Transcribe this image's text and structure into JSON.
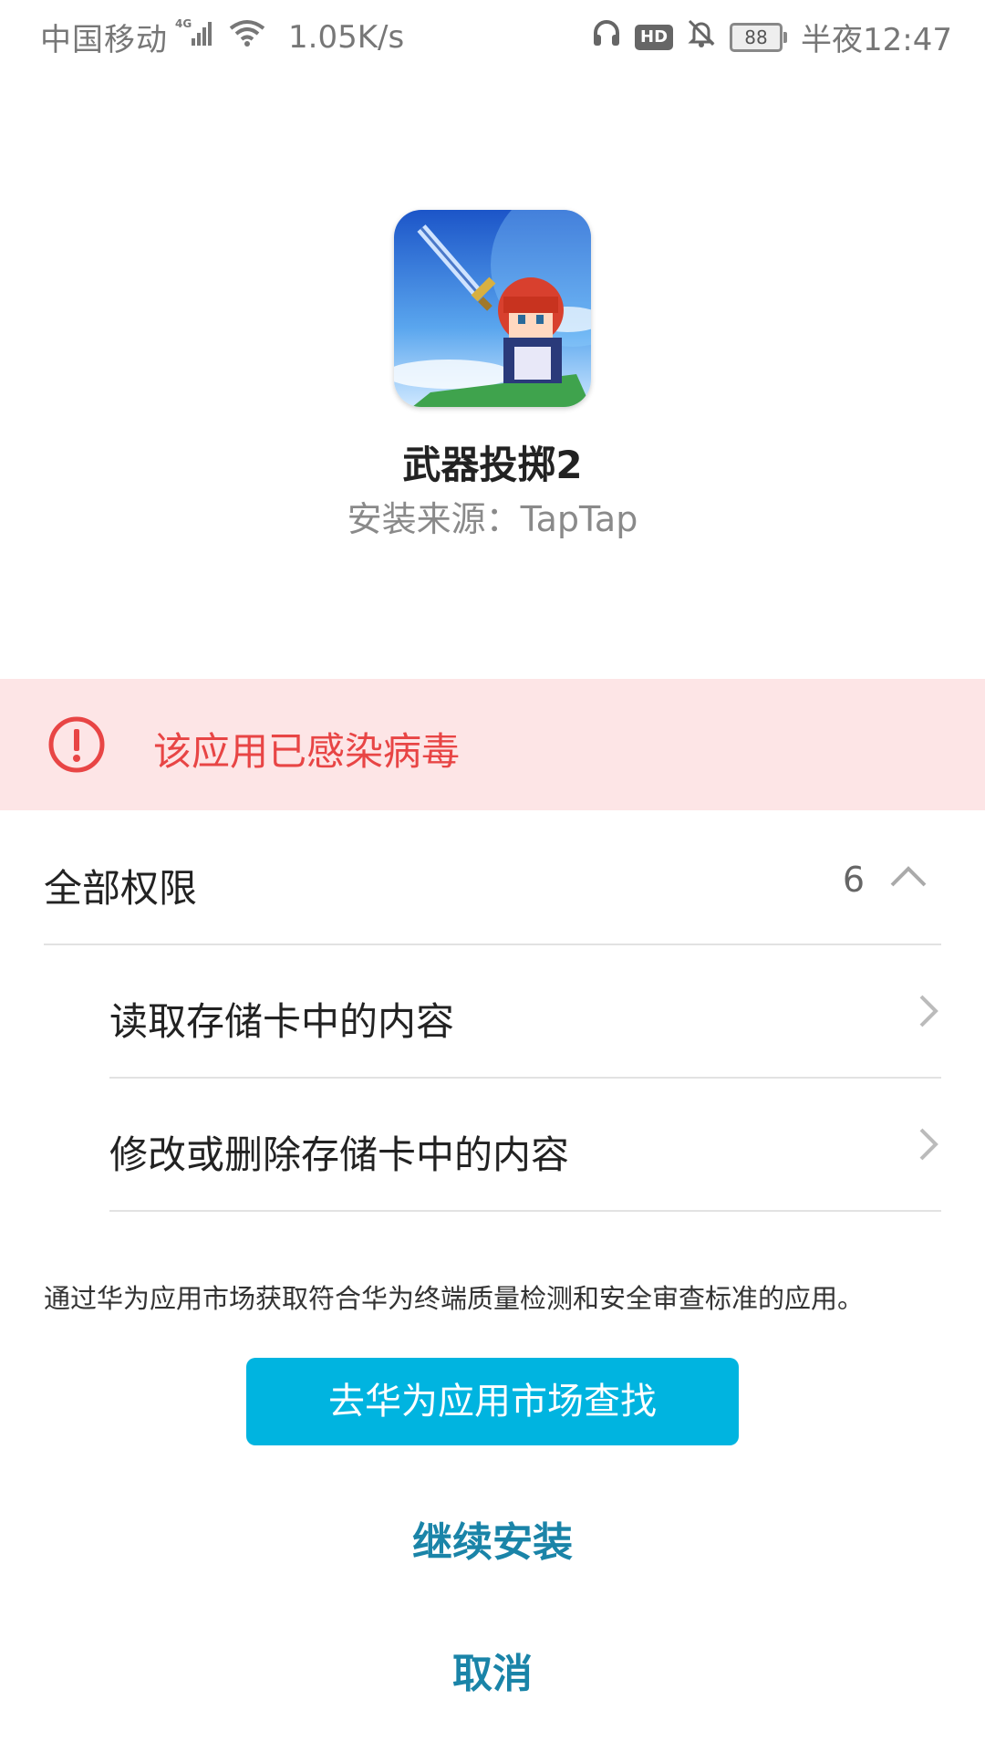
{
  "status_bar": {
    "carrier": "中国移动",
    "network": "4G",
    "speed": "1.05K/s",
    "hd": "HD",
    "battery": "88",
    "time": "半夜12:47"
  },
  "app": {
    "name": "武器投掷2",
    "source": "安装来源：TapTap"
  },
  "warning": {
    "text": "该应用已感染病毒",
    "color": "#e84545"
  },
  "permissions": {
    "title": "全部权限",
    "count": "6",
    "items": [
      {
        "label": "读取存储卡中的内容"
      },
      {
        "label": "修改或删除存储卡中的内容"
      }
    ]
  },
  "note": "通过华为应用市场获取符合华为终端质量检测和安全审查标准的应用。",
  "buttons": {
    "market": "去华为应用市场查找",
    "continue": "继续安装",
    "cancel": "取消"
  },
  "colors": {
    "accent": "#00b4e0",
    "link": "#1a84a8",
    "warning_bg": "#fde5e6"
  }
}
